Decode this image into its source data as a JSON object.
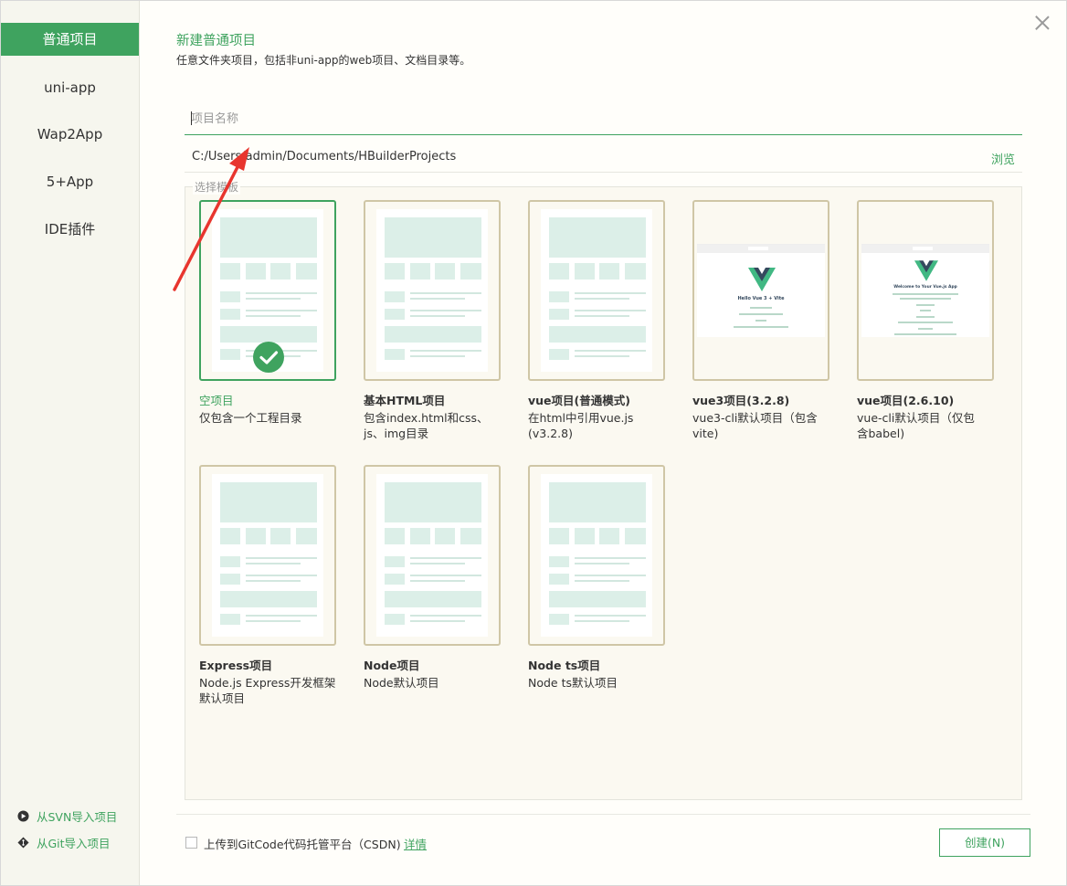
{
  "sidebar": {
    "items": [
      {
        "label": "普通项目",
        "active": true
      },
      {
        "label": "uni-app"
      },
      {
        "label": "Wap2App"
      },
      {
        "label": "5+App"
      },
      {
        "label": "IDE插件"
      }
    ],
    "import_svn": "从SVN导入项目",
    "import_git": "从Git导入项目"
  },
  "main": {
    "title": "新建普通项目",
    "subtitle": "任意文件夹项目，包括非uni-app的web项目、文档目录等。",
    "name_placeholder": "项目名称",
    "path": "C:/Users/admin/Documents/HBuilderProjects",
    "browse": "浏览",
    "template_legend": "选择模板"
  },
  "templates": [
    {
      "title": "空项目",
      "desc": "仅包含一个工程目录",
      "selected": true
    },
    {
      "title": "基本HTML项目",
      "desc": "包含index.html和css、js、img目录"
    },
    {
      "title": "vue项目(普通模式)",
      "desc": "在html中引用vue.js (v3.2.8)"
    },
    {
      "title": "vue3项目(3.2.8)",
      "desc": "vue3-cli默认项目（包含vite)",
      "preview_heading": "Hello Vue 3 + Vite"
    },
    {
      "title": "vue项目(2.6.10)",
      "desc": "vue-cli默认项目（仅包含babel)",
      "preview_heading": "Welcome to Your Vue.js App"
    },
    {
      "title": "Express项目",
      "desc": "Node.js Express开发框架默认项目"
    },
    {
      "title": "Node项目",
      "desc": "Node默认项目"
    },
    {
      "title": "Node ts项目",
      "desc": "Node ts默认项目"
    }
  ],
  "footer": {
    "upload_label": "上传到GitCode代码托管平台（CSDN)",
    "upload_checked": false,
    "details": "详情",
    "create": "创建(N)"
  },
  "colors": {
    "accent": "#3fa35f",
    "card_border": "#cfc6a6",
    "annotation_arrow": "#e8352e"
  }
}
